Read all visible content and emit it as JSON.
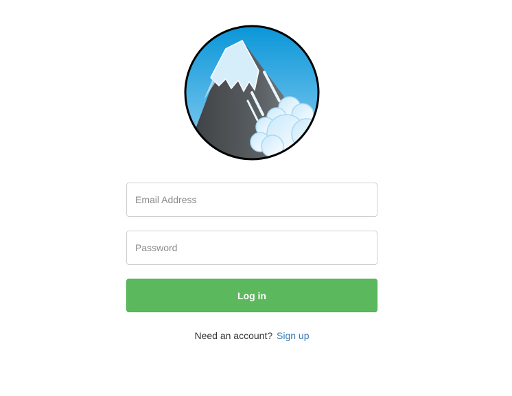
{
  "login_form": {
    "email_placeholder": "Email Address",
    "email_value": "",
    "password_placeholder": "Password",
    "password_value": "",
    "login_button_label": "Log in",
    "signup_prompt": "Need an account?",
    "signup_link_label": "Sign up"
  },
  "logo": {
    "icon": "mountain-avalanche-logo-icon"
  },
  "colors": {
    "login_button": "#5cb85c",
    "link": "#337ab7",
    "field_border": "#cfcfcf",
    "sky": "#2b9ad6",
    "mountain": "#555a5e",
    "snow": "#dff1fb"
  }
}
